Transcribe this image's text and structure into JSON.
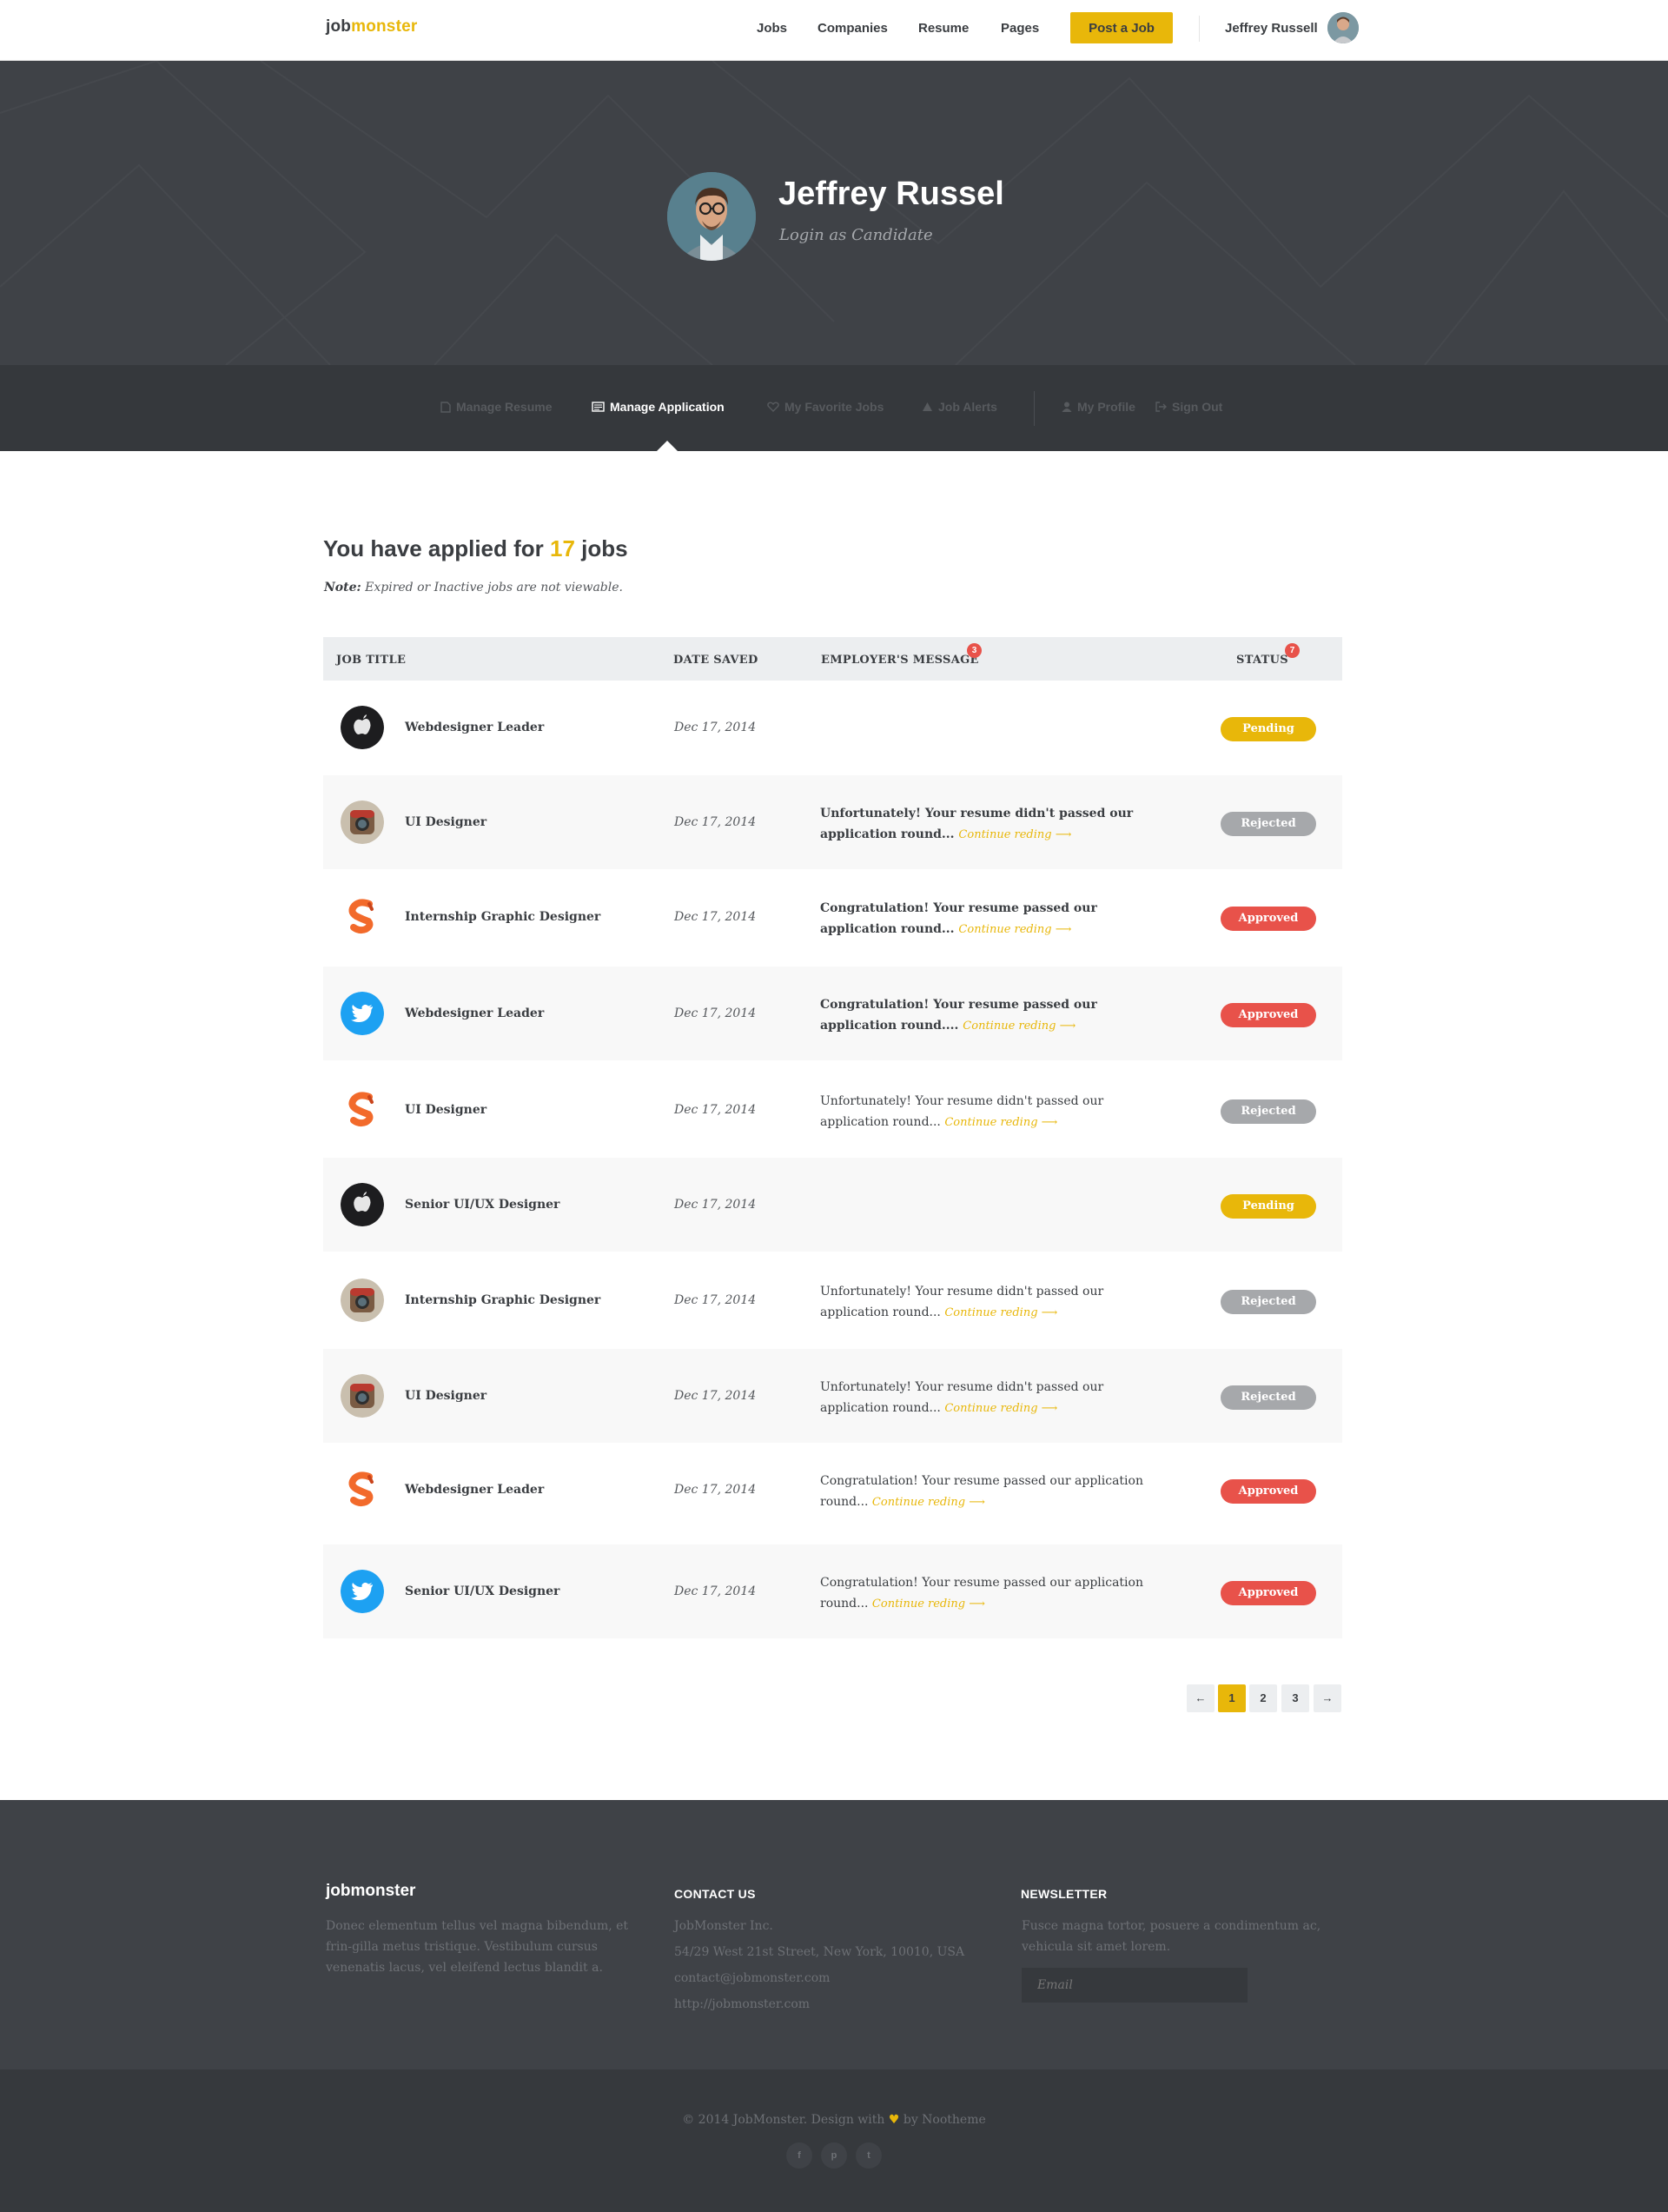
{
  "header": {
    "logo_part1": "job",
    "logo_part2": "monster",
    "nav": [
      "Jobs",
      "Companies",
      "Resume",
      "Pages"
    ],
    "post_job_label": "Post a Job",
    "user_name": "Jeffrey Russell"
  },
  "hero": {
    "name": "Jeffrey Russel",
    "subtitle": "Login as Candidate"
  },
  "dashboard_nav": [
    {
      "label": "Manage Resume",
      "icon": "document-icon",
      "active": false
    },
    {
      "label": "Manage Application",
      "icon": "newspaper-icon",
      "active": true
    },
    {
      "label": "My Favorite Jobs",
      "icon": "heart-icon",
      "active": false
    },
    {
      "label": "Job Alerts",
      "icon": "warning-icon",
      "active": false
    },
    {
      "label": "My Profile",
      "icon": "user-icon",
      "active": false
    },
    {
      "label": "Sign Out",
      "icon": "sign-out-icon",
      "active": false
    }
  ],
  "main": {
    "headline_prefix": "You have applied for ",
    "applied_count": "17",
    "headline_suffix": " jobs",
    "note_label": "Note:",
    "note_text": " Expired or Inactive jobs are not viewable."
  },
  "table": {
    "columns": [
      "JOB TITLE",
      "DATE SAVED",
      "EMPLOYER'S MESSAGE",
      "STATUS"
    ],
    "message_badge": "3",
    "status_badge": "7",
    "rows": [
      {
        "logo": "apple-logo",
        "title": "Webdesigner Leader",
        "date": "Dec 17, 2014",
        "message": "",
        "more": "",
        "status": "Pending"
      },
      {
        "logo": "instagram-logo",
        "title": "UI Designer",
        "date": "Dec 17, 2014",
        "message": "Unfortunately! Your resume didn't passed our application round...",
        "more": "Continue reding",
        "status": "Rejected"
      },
      {
        "logo": "scribd-logo",
        "title": "Internship Graphic Designer",
        "date": "Dec 17, 2014",
        "message": "Congratulation! Your resume passed our application round...",
        "more": "Continue reding",
        "status": "Approved"
      },
      {
        "logo": "twitter-logo",
        "title": "Webdesigner Leader",
        "date": "Dec 17, 2014",
        "message": "Congratulation! Your resume passed our application round....",
        "more": "Continue reding",
        "status": "Approved"
      },
      {
        "logo": "scribd-logo",
        "title": "UI Designer",
        "date": "Dec 17, 2014",
        "message": "Unfortunately! Your resume didn't passed our application round...",
        "more": "Continue reding",
        "status": "Rejected"
      },
      {
        "logo": "apple-logo",
        "title": "Senior UI/UX Designer",
        "date": "Dec 17, 2014",
        "message": "",
        "more": "",
        "status": "Pending"
      },
      {
        "logo": "instagram-logo",
        "title": "Internship Graphic Designer",
        "date": "Dec 17, 2014",
        "message": "Unfortunately! Your resume didn't passed our application round...",
        "more": "Continue reding",
        "status": "Rejected"
      },
      {
        "logo": "instagram-logo",
        "title": "UI Designer",
        "date": "Dec 17, 2014",
        "message": "Unfortunately! Your resume didn't passed our application round...",
        "more": "Continue reding",
        "status": "Rejected"
      },
      {
        "logo": "scribd-logo",
        "title": "Webdesigner Leader",
        "date": "Dec 17, 2014",
        "message": "Congratulation! Your resume passed our application round...",
        "more": "Continue reding",
        "status": "Approved"
      },
      {
        "logo": "twitter-logo",
        "title": "Senior UI/UX Designer",
        "date": "Dec 17, 2014",
        "message": "Congratulation! Your resume passed our application round...",
        "more": "Continue reding",
        "status": "Approved"
      }
    ]
  },
  "pagination": {
    "prev": "←",
    "pages": [
      "1",
      "2",
      "3"
    ],
    "current": "1",
    "next": "→"
  },
  "footer": {
    "logo": "jobmonster",
    "about": "Donec elementum tellus vel magna bibendum, et frin-gilla metus tristique. Vestibulum cursus venenatis lacus, vel eleifend lectus blandit a.",
    "contact_heading": "CONTACT US",
    "contact_lines": [
      "JobMonster Inc.",
      "54/29 West 21st Street, New York, 10010, USA",
      "contact@jobmonster.com",
      "http://jobmonster.com"
    ],
    "newsletter_heading": "NEWSLETTER",
    "newsletter_text": "Fusce magna tortor, posuere a condimentum ac, vehicula sit amet lorem.",
    "email_placeholder": "Email",
    "copyright_prefix": "© 2014 JobMonster. Design with ",
    "copyright_suffix": " by Nootheme",
    "social": [
      "facebook-icon",
      "pinterest-icon",
      "twitter-icon"
    ]
  },
  "colors": {
    "accent": "#e8b70a",
    "approved": "#e8524a",
    "rejected": "#a6a8ab",
    "dark": "#3f4247"
  }
}
